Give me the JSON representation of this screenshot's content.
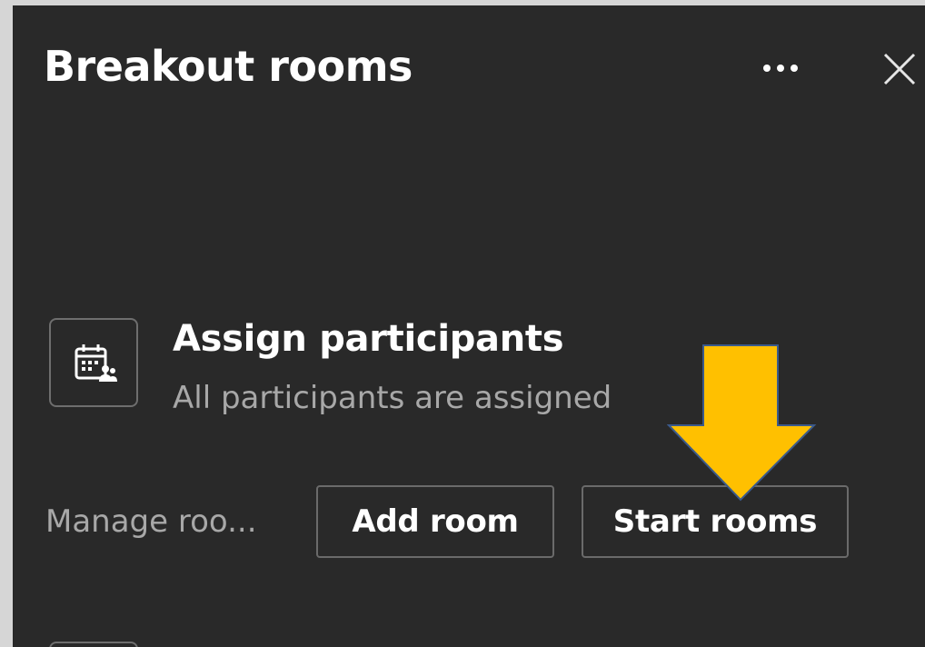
{
  "panel": {
    "title": "Breakout rooms",
    "more_icon": "more-horizontal-icon",
    "close_icon": "close-icon"
  },
  "assign": {
    "icon": "calendar-people-icon",
    "title": "Assign participants",
    "subtitle": "All participants are assigned"
  },
  "manage": {
    "label": "Manage roo...",
    "add_room_label": "Add room",
    "start_rooms_label": "Start rooms"
  },
  "annotation": {
    "arrow_icon": "down-arrow-icon",
    "arrow_color": "#ffc000"
  },
  "colors": {
    "panel_bg": "#292929",
    "outer_bg": "#d6d6d6",
    "text_primary": "#ffffff",
    "text_secondary": "#a8a8a8",
    "border": "#6a6a6a"
  }
}
